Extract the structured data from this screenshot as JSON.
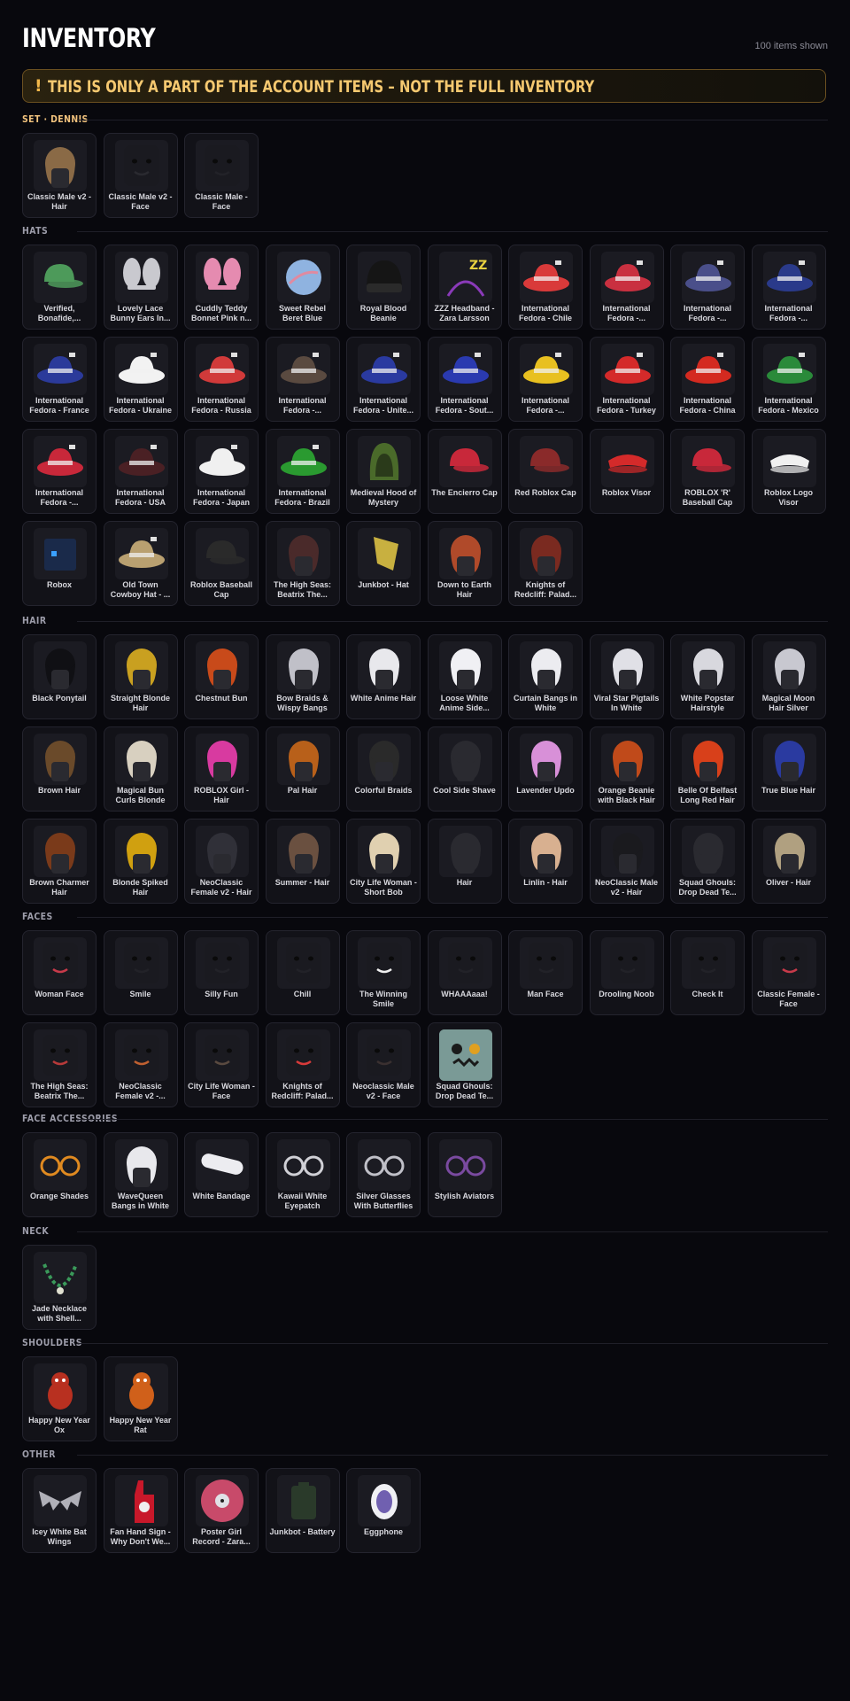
{
  "header": {
    "title": "INVENTORY",
    "count": "100 items shown"
  },
  "warning": {
    "icon": "!",
    "text": "THIS IS ONLY A PART OF THE ACCOUNT ITEMS – NOT THE FULL INVENTORY"
  },
  "sections": [
    {
      "title": "SET · DENNIS",
      "style": "set",
      "items": [
        {
          "label": "Classic Male v2 - Hair",
          "icon": "hair",
          "color": "#8a6a46"
        },
        {
          "label": "Classic Male v2 - Face",
          "icon": "face",
          "color": "#2a2a30"
        },
        {
          "label": "Classic Male - Face",
          "icon": "face",
          "color": "#222228"
        }
      ]
    },
    {
      "title": "HATS",
      "style": "gray",
      "items": [
        {
          "label": "Verified, Bonafide,...",
          "icon": "cap",
          "color": "#4d9a5a"
        },
        {
          "label": "Lovely Lace Bunny Ears In...",
          "icon": "bunny",
          "color": "#c9c9cf"
        },
        {
          "label": "Cuddly Teddy Bonnet Pink n...",
          "icon": "bunny",
          "color": "#e58bb0"
        },
        {
          "label": "Sweet Rebel Beret Blue",
          "icon": "orb",
          "color": "#8fb3e0"
        },
        {
          "label": "Royal Blood Beanie",
          "icon": "beanie",
          "color": "#151515"
        },
        {
          "label": "ZZZ Headband - Zara Larsson",
          "icon": "headband",
          "color": "#8a3ab9"
        },
        {
          "label": "International Fedora - Chile",
          "icon": "fedora",
          "color": "#d93a3a"
        },
        {
          "label": "International Fedora -...",
          "icon": "fedora",
          "color": "#c93040"
        },
        {
          "label": "International Fedora -...",
          "icon": "fedora",
          "color": "#4a4f8a"
        },
        {
          "label": "International Fedora -...",
          "icon": "fedora",
          "color": "#2a3a8a"
        },
        {
          "label": "International Fedora - France",
          "icon": "fedora",
          "color": "#2b3a9a"
        },
        {
          "label": "International Fedora - Ukraine",
          "icon": "fedora",
          "color": "#f2f2f2"
        },
        {
          "label": "International Fedora - Russia",
          "icon": "fedora",
          "color": "#d13a3a"
        },
        {
          "label": "International Fedora -...",
          "icon": "fedora",
          "color": "#5a4a40"
        },
        {
          "label": "International Fedora - Unite...",
          "icon": "fedora",
          "color": "#2a3aa0"
        },
        {
          "label": "International Fedora - Sout...",
          "icon": "fedora",
          "color": "#2a3ab0"
        },
        {
          "label": "International Fedora -...",
          "icon": "fedora",
          "color": "#e8c020"
        },
        {
          "label": "International Fedora - Turkey",
          "icon": "fedora",
          "color": "#d42a2a"
        },
        {
          "label": "International Fedora - China",
          "icon": "fedora",
          "color": "#d42a20"
        },
        {
          "label": "International Fedora - Mexico",
          "icon": "fedora",
          "color": "#2a8a3a"
        },
        {
          "label": "International Fedora -...",
          "icon": "fedora",
          "color": "#c8283a"
        },
        {
          "label": "International Fedora - USA",
          "icon": "fedora",
          "color": "#4a2024"
        },
        {
          "label": "International Fedora - Japan",
          "icon": "fedora",
          "color": "#f0f0f0"
        },
        {
          "label": "International Fedora - Brazil",
          "icon": "fedora",
          "color": "#2a9a30"
        },
        {
          "label": "Medieval Hood of Mystery",
          "icon": "hood",
          "color": "#4a6a2a"
        },
        {
          "label": "The Encierro Cap",
          "icon": "cap",
          "color": "#c8283a"
        },
        {
          "label": "Red Roblox Cap",
          "icon": "cap",
          "color": "#8a2a2a"
        },
        {
          "label": "Roblox Visor",
          "icon": "visor",
          "color": "#d42a2a"
        },
        {
          "label": "ROBLOX 'R' Baseball Cap",
          "icon": "cap",
          "color": "#c8283a"
        },
        {
          "label": "Roblox Logo Visor",
          "icon": "visor",
          "color": "#f0f0f0"
        },
        {
          "label": "Robox",
          "icon": "box",
          "color": "#1a2a4a"
        },
        {
          "label": "Old Town Cowboy Hat - ...",
          "icon": "fedora",
          "color": "#b9a070"
        },
        {
          "label": "Roblox Baseball Cap",
          "icon": "cap",
          "color": "#2a2a2a"
        },
        {
          "label": "The High Seas: Beatrix The...",
          "icon": "hair",
          "color": "#4a2a2a"
        },
        {
          "label": "Junkbot - Hat",
          "icon": "flag",
          "color": "#c8b040"
        },
        {
          "label": "Down to Earth Hair",
          "icon": "hair",
          "color": "#b04a2a"
        },
        {
          "label": "Knights of Redcliff: Palad...",
          "icon": "hair",
          "color": "#7a2a20"
        }
      ]
    },
    {
      "title": "HAIR",
      "style": "gray",
      "items": [
        {
          "label": "Black Ponytail",
          "icon": "hair",
          "color": "#101014"
        },
        {
          "label": "Straight Blonde Hair",
          "icon": "hair",
          "color": "#c9a020"
        },
        {
          "label": "Chestnut Bun",
          "icon": "hair",
          "color": "#c84a1a"
        },
        {
          "label": "Bow Braids & Wispy Bangs",
          "icon": "hair",
          "color": "#c0c0c8"
        },
        {
          "label": "White Anime Hair",
          "icon": "hair",
          "color": "#e8e8ec"
        },
        {
          "label": "Loose White Anime Side...",
          "icon": "hair",
          "color": "#f0f0f4"
        },
        {
          "label": "Curtain Bangs in White",
          "icon": "hair",
          "color": "#ececf0"
        },
        {
          "label": "Viral Star Pigtails In White",
          "icon": "hair",
          "color": "#e0e0e6"
        },
        {
          "label": "White Popstar Hairstyle",
          "icon": "hair",
          "color": "#d8d8de"
        },
        {
          "label": "Magical Moon Hair Silver",
          "icon": "hair",
          "color": "#c8c8d0"
        },
        {
          "label": "Brown Hair",
          "icon": "hair",
          "color": "#6a4a2a"
        },
        {
          "label": "Magical Bun Curls Blonde",
          "icon": "hair",
          "color": "#d8d0c0"
        },
        {
          "label": "ROBLOX Girl - Hair",
          "icon": "hair",
          "color": "#d83aa0"
        },
        {
          "label": "Pal Hair",
          "icon": "hair",
          "color": "#b8601a"
        },
        {
          "label": "Colorful Braids",
          "icon": "hair",
          "color": "#2a2a2a"
        },
        {
          "label": "Cool Side Shave",
          "icon": "hair",
          "color": "#2a2a30"
        },
        {
          "label": "Lavender Updo",
          "icon": "hair",
          "color": "#d890d8"
        },
        {
          "label": "Orange Beanie with Black Hair",
          "icon": "hair",
          "color": "#c04a1a"
        },
        {
          "label": "Belle Of Belfast Long Red Hair",
          "icon": "hair",
          "color": "#d8401a"
        },
        {
          "label": "True Blue Hair",
          "icon": "hair",
          "color": "#2a3aa0"
        },
        {
          "label": "Brown Charmer Hair",
          "icon": "hair",
          "color": "#7a3a1a"
        },
        {
          "label": "Blonde Spiked Hair",
          "icon": "hair",
          "color": "#d0a010"
        },
        {
          "label": "NeoClassic Female v2 - Hair",
          "icon": "hair",
          "color": "#303038"
        },
        {
          "label": "Summer - Hair",
          "icon": "hair",
          "color": "#6a5040"
        },
        {
          "label": "City Life Woman - Short Bob",
          "icon": "hair",
          "color": "#e0d0b0"
        },
        {
          "label": "Hair",
          "icon": "hair",
          "color": "#2a2a30"
        },
        {
          "label": "Linlin - Hair",
          "icon": "hair",
          "color": "#d8b090"
        },
        {
          "label": "NeoClassic Male v2 - Hair",
          "icon": "hair",
          "color": "#1a1a1e"
        },
        {
          "label": "Squad Ghouls: Drop Dead Te...",
          "icon": "hair",
          "color": "#2a2a30"
        },
        {
          "label": "Oliver - Hair",
          "icon": "hair",
          "color": "#b0a080"
        }
      ]
    },
    {
      "title": "FACES",
      "style": "gray",
      "items": [
        {
          "label": "Woman Face",
          "icon": "face",
          "color": "#c83a4a"
        },
        {
          "label": "Smile",
          "icon": "face",
          "color": "#222228"
        },
        {
          "label": "Silly Fun",
          "icon": "face",
          "color": "#222228"
        },
        {
          "label": "Chill",
          "icon": "face",
          "color": "#222228"
        },
        {
          "label": "The Winning Smile",
          "icon": "face",
          "color": "#f0f0f0"
        },
        {
          "label": "WHAAAaaa!",
          "icon": "face",
          "color": "#222228"
        },
        {
          "label": "Man Face",
          "icon": "face",
          "color": "#222228"
        },
        {
          "label": "Drooling Noob",
          "icon": "face",
          "color": "#222228"
        },
        {
          "label": "Check It",
          "icon": "face",
          "color": "#222228"
        },
        {
          "label": "Classic Female - Face",
          "icon": "face",
          "color": "#c83a4a"
        },
        {
          "label": "The High Seas: Beatrix The...",
          "icon": "face",
          "color": "#b83a3a"
        },
        {
          "label": "NeoClassic Female v2 -...",
          "icon": "face",
          "color": "#c06030"
        },
        {
          "label": "City Life Woman - Face",
          "icon": "face",
          "color": "#5a4a40"
        },
        {
          "label": "Knights of Redcliff: Palad...",
          "icon": "face",
          "color": "#d83a3a"
        },
        {
          "label": "Neoclassic Male v2 - Face",
          "icon": "face",
          "color": "#3a3030"
        },
        {
          "label": "Squad Ghouls: Drop Dead Te...",
          "icon": "ghoul",
          "color": "#e0a020"
        }
      ]
    },
    {
      "title": "FACE ACCESSORIES",
      "style": "gray",
      "items": [
        {
          "label": "Orange Shades",
          "icon": "glasses",
          "color": "#e08a20"
        },
        {
          "label": "WaveQueen Bangs in White",
          "icon": "hair",
          "color": "#e8e8ec"
        },
        {
          "label": "White Bandage",
          "icon": "bandage",
          "color": "#ececf0"
        },
        {
          "label": "Kawaii White Eyepatch",
          "icon": "glasses",
          "color": "#d0d0d6"
        },
        {
          "label": "Silver Glasses With Butterflies",
          "icon": "glasses",
          "color": "#c0c0c8"
        },
        {
          "label": "Stylish Aviators",
          "icon": "glasses",
          "color": "#7a4aa0"
        }
      ]
    },
    {
      "title": "NECK",
      "style": "gray",
      "items": [
        {
          "label": "Jade Necklace with Shell...",
          "icon": "necklace",
          "color": "#3a9a5a"
        }
      ]
    },
    {
      "title": "SHOULDERS",
      "style": "gray",
      "items": [
        {
          "label": "Happy New Year Ox",
          "icon": "pet",
          "color": "#b83020"
        },
        {
          "label": "Happy New Year Rat",
          "icon": "pet",
          "color": "#d0601a"
        }
      ]
    },
    {
      "title": "OTHER",
      "style": "gray",
      "items": [
        {
          "label": "Icey White Bat Wings",
          "icon": "wings",
          "color": "#b0b0b8"
        },
        {
          "label": "Fan Hand Sign - Why Don't We...",
          "icon": "foamhand",
          "color": "#c8182a"
        },
        {
          "label": "Poster Girl Record - Zara...",
          "icon": "record",
          "color": "#c84a6a"
        },
        {
          "label": "Junkbot - Battery",
          "icon": "battery",
          "color": "#2a3a2a"
        },
        {
          "label": "Eggphone",
          "icon": "egg",
          "color": "#7060b0"
        }
      ]
    }
  ]
}
